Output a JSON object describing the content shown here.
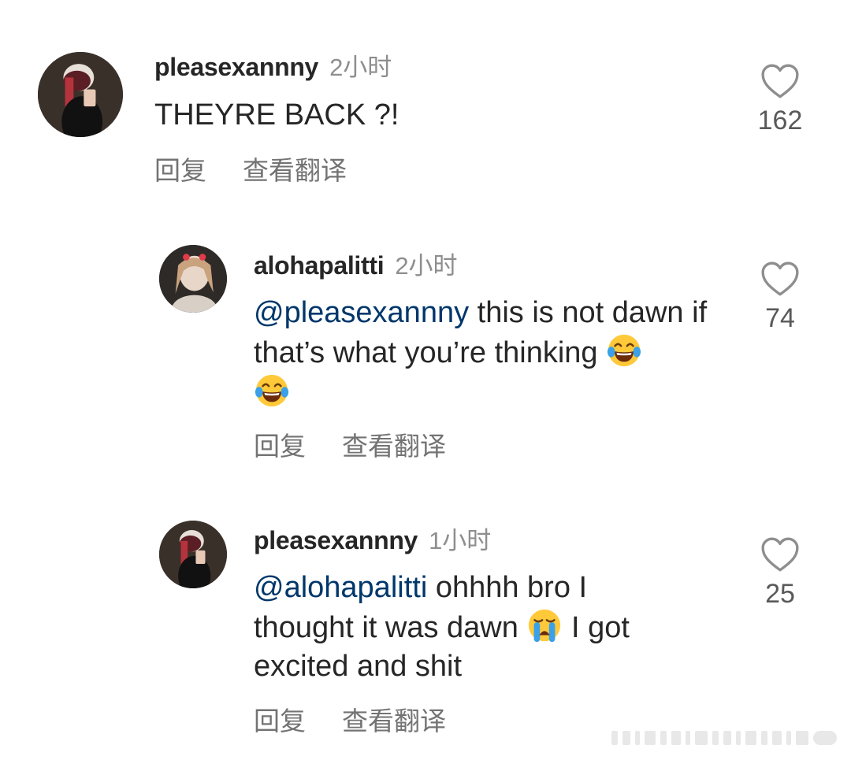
{
  "comments": [
    {
      "username": "pleasexannny",
      "time": "2小时",
      "mention": "",
      "text_before": "THEYRE BACK ?!",
      "reply_label": "回复",
      "translate_label": "查看翻译",
      "likes": "162"
    },
    {
      "username": "alohapalitti",
      "time": "2小时",
      "mention": "@pleasexannny",
      "text_before": " this is not dawn if that’s what you’re thinking ",
      "text_after": "",
      "reply_label": "回复",
      "translate_label": "查看翻译",
      "likes": "74"
    },
    {
      "username": "pleasexannny",
      "time": "1小时",
      "mention": "@alohapalitti",
      "text_before": " ohhhh bro I thought it was dawn ",
      "text_after": " I got excited and shit",
      "reply_label": "回复",
      "translate_label": "查看翻译",
      "likes": "25"
    }
  ],
  "icons": {
    "like": "heart-outline-icon",
    "laughing_emoji": "face-with-tears-of-joy-emoji",
    "crying_emoji": "loudly-crying-face-emoji"
  },
  "colors": {
    "mention": "#00376b",
    "muted": "#8e8e8e",
    "text": "#262626"
  }
}
